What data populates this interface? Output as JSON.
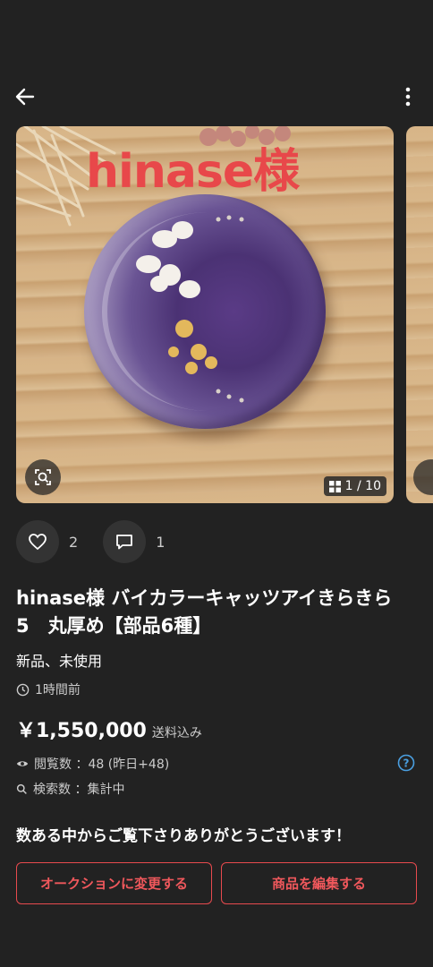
{
  "photo": {
    "overlay_text": "hinase様",
    "counter": "1 / 10"
  },
  "actions": {
    "likes": "2",
    "comments": "1"
  },
  "item": {
    "title": "hinase様 バイカラーキャッツアイきらきら　5　丸厚め【部品6種】",
    "condition": "新品、未使用",
    "posted": "1時間前",
    "price": "￥1,550,000",
    "shipping": "送料込み",
    "views_label": "閲覧数 ：48 (昨日+48)",
    "search_label": "検索数 ：集計中",
    "thanks_message": "数ある中からご覧下さりありがとうございます！"
  },
  "buttons": {
    "auction": "オークションに変更する",
    "edit": "商品を編集する"
  },
  "colors": {
    "background": "#222222",
    "accent": "#e84a4e",
    "help_icon": "#4a9fe0"
  },
  "icons": [
    "back-arrow-icon",
    "more-vert-icon",
    "lens-search-icon",
    "grid-icon",
    "heart-icon",
    "comment-icon",
    "clock-icon",
    "eye-icon",
    "search-icon",
    "help-icon"
  ]
}
